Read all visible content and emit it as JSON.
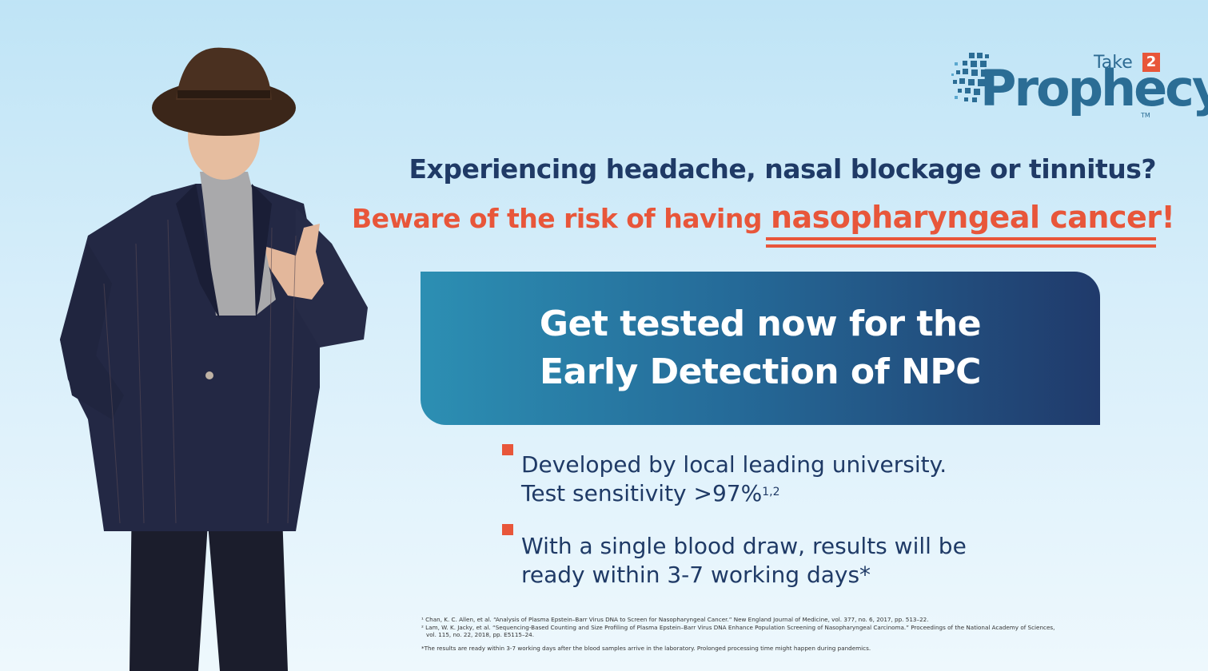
{
  "logo": {
    "take": "Take",
    "two": "2",
    "word": "Prophecy",
    "tm": "TM"
  },
  "headline": {
    "question": "Experiencing headache, nasal blockage or tinnitus?",
    "warning_prefix": "Beware of the risk of having ",
    "warning_emphasis": "nasopharyngeal cancer!"
  },
  "cta": {
    "line1": "Get tested now for the",
    "line2": "Early Detection of NPC"
  },
  "bullets": [
    {
      "line1": "Developed by local leading university.",
      "line2": "Test sensitivity >97%",
      "sup": "1,2"
    },
    {
      "line1": "With a single blood draw, results will be",
      "line2": "ready within 3-7 working days*"
    }
  ],
  "footnotes": {
    "ref1": "¹ Chan, K. C. Allen, et al. “Analysis of Plasma Epstein–Barr Virus DNA to Screen for Nasopharyngeal Cancer.” New England Journal of Medicine, vol. 377, no. 6, 2017, pp. 513–22.",
    "ref2a": "² Lam, W. K. Jacky, et al. “Sequencing-Based Counting and Size Profiling of Plasma Epstein–Barr Virus DNA Enhance Population Screening of Nasopharyngeal Carcinoma.” Proceedings of the National Academy of Sciences,",
    "ref2b": "vol. 115, no. 22, 2018, pp. E5115–24.",
    "note": "*The results are ready within 3-7 working days after the blood samples arrive in the laboratory. Prolonged processing time might happen during pandemics."
  },
  "colors": {
    "navy": "#1f3a66",
    "orange": "#e8563a",
    "brand_blue": "#2b6d95"
  }
}
